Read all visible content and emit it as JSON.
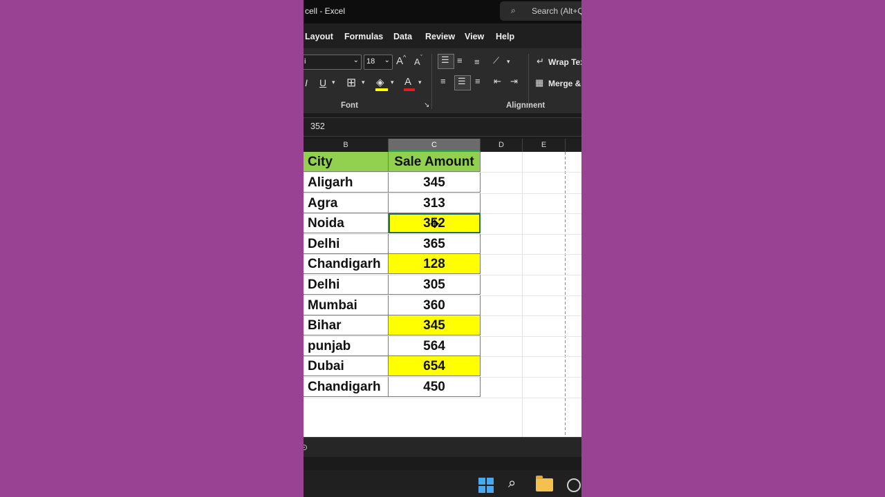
{
  "window": {
    "title": "cell  -  Excel"
  },
  "search": {
    "label": "Search (Alt+Q)"
  },
  "menu": {
    "tabs": [
      "Layout",
      "Formulas",
      "Data",
      "Review",
      "View",
      "Help"
    ]
  },
  "ribbon": {
    "font_name": "i",
    "font_size": "18",
    "grow_font": "A",
    "shrink_font": "A",
    "italic": "I",
    "underline": "U",
    "font_color_glyph": "A",
    "font_group_label": "Font",
    "alignment_group_label": "Alignment",
    "wrap_text": "Wrap Text",
    "merge_center": "Merge &"
  },
  "formula_bar": {
    "value": "352"
  },
  "columns": [
    "B",
    "C",
    "D",
    "E"
  ],
  "sheet": {
    "header": {
      "city": "City",
      "amount": "Sale Amount"
    },
    "rows": [
      {
        "city": "Aligarh",
        "amount": "345",
        "highlight": false
      },
      {
        "city": "Agra",
        "amount": "313",
        "highlight": false
      },
      {
        "city": "Noida",
        "amount": "352",
        "highlight": true
      },
      {
        "city": "Delhi",
        "amount": "365",
        "highlight": false
      },
      {
        "city": "Chandigarh",
        "amount": "128",
        "highlight": true
      },
      {
        "city": "Delhi",
        "amount": "305",
        "highlight": false
      },
      {
        "city": "Mumbai",
        "amount": "360",
        "highlight": false
      },
      {
        "city": "Bihar",
        "amount": "345",
        "highlight": true
      },
      {
        "city": "punjab",
        "amount": "564",
        "highlight": false
      },
      {
        "city": "Dubai",
        "amount": "654",
        "highlight": true
      },
      {
        "city": "Chandigarh",
        "amount": "450",
        "highlight": false
      }
    ],
    "active_row": 2,
    "header_color": "#92d050",
    "highlight_color": "#ffff00"
  },
  "colors": {
    "background": "#994294",
    "accent": "#217346"
  }
}
